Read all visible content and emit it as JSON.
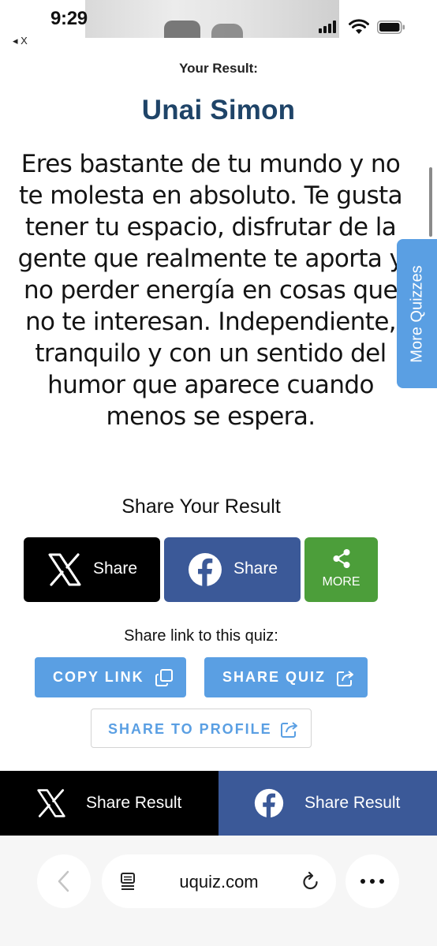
{
  "status_bar": {
    "time": "9:29",
    "back_app": "◂ X"
  },
  "result": {
    "heading": "Your Result:",
    "name": "Unai Simon",
    "description": "Eres bastante de tu mundo y no te molesta en absoluto. Te gusta tener tu espacio, disfrutar de la gente que realmente te aporta y no perder energía en cosas que no te interesan. Independiente, tranquilo y con un sentido del humor que aparece cuando menos se espera."
  },
  "side_tab": {
    "label": "More Quizzes"
  },
  "share": {
    "heading": "Share Your Result",
    "x_label": "Share",
    "facebook_label": "Share",
    "more_label": "MORE"
  },
  "share_link": {
    "label": "Share link to this quiz:",
    "copy_link": "COPY LINK",
    "share_quiz": "SHARE QUIZ",
    "share_to_profile": "SHARE TO PROFILE"
  },
  "bottom_share_bar": {
    "x_label": "Share Result",
    "facebook_label": "Share Result"
  },
  "browser": {
    "url": "uquiz.com"
  },
  "colors": {
    "name_text": "#1f4468",
    "accent_blue": "#5a9fe3",
    "facebook_blue": "#3b5998",
    "more_green": "#4c9e3a",
    "x_black": "#000000"
  },
  "icons": [
    "x-logo-icon",
    "facebook-icon",
    "share-nodes-icon",
    "copy-icon",
    "share-out-icon",
    "reader-icon",
    "reload-icon",
    "back-chevron-icon",
    "more-dots-icon",
    "signal-icon",
    "wifi-icon",
    "battery-icon"
  ]
}
